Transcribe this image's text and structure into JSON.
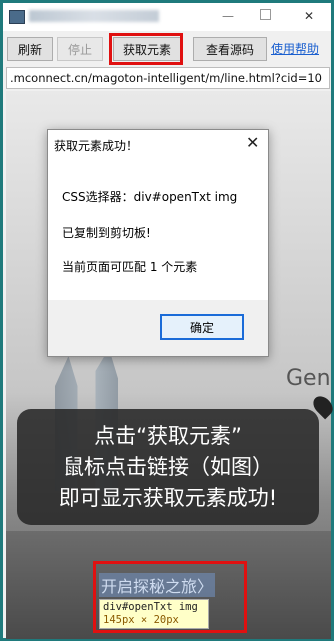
{
  "window": {
    "title": ""
  },
  "toolbar": {
    "refresh": "刷新",
    "stop": "停止",
    "get_element": "获取元素",
    "view_source": "查看源码",
    "help": "使用帮助"
  },
  "url": ".mconnect.cn/magoton-intelligent/m/line.html?cid=10",
  "page": {
    "brand_partial": "Gene"
  },
  "dialog": {
    "title": "获取元素成功！",
    "selector_line": "CSS选择器：div#openTxt img",
    "copied_line": "已复制到剪切板!",
    "match_line": "当前页面可匹配 1 个元素",
    "ok": "确定"
  },
  "callout": {
    "line1": "点击“获取元素”",
    "line2": "鼠标点击链接（如图）",
    "line3": "即可显示获取元素成功!"
  },
  "link": {
    "text": "开启探秘之旅〉"
  },
  "tooltip": {
    "selector": "div#openTxt img",
    "size": "145px × 20px"
  }
}
